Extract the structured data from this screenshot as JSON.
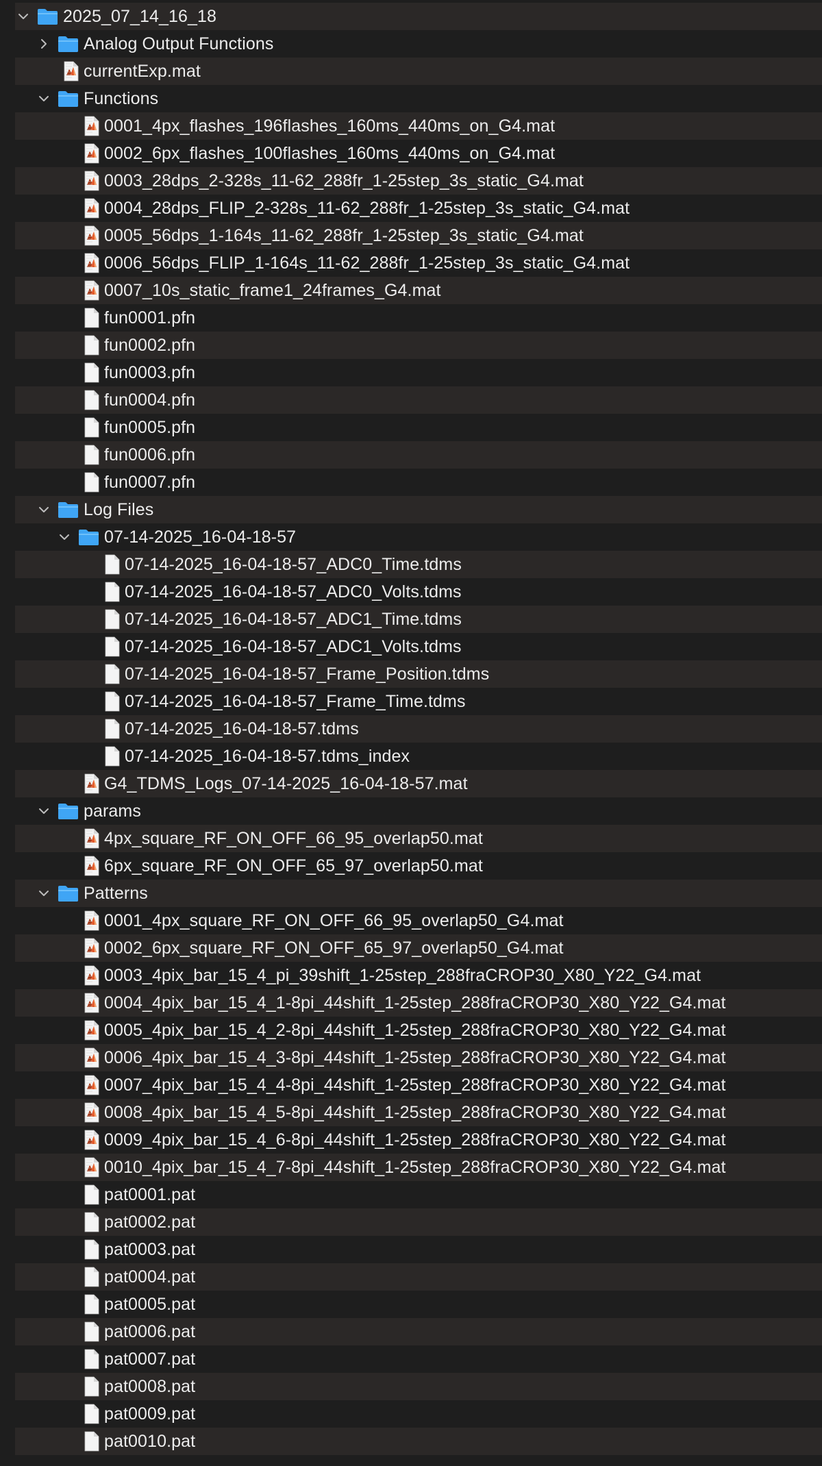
{
  "tree": [
    {
      "label": "2025_07_14_16_18",
      "kind": "folder",
      "depth": 0,
      "expanded": true
    },
    {
      "label": "Analog Output Functions",
      "kind": "folder",
      "depth": 1,
      "expanded": false
    },
    {
      "label": "currentExp.mat",
      "kind": "mat",
      "depth": 1
    },
    {
      "label": "Functions",
      "kind": "folder",
      "depth": 1,
      "expanded": true
    },
    {
      "label": "0001_4px_flashes_196flashes_160ms_440ms_on_G4.mat",
      "kind": "mat",
      "depth": 2
    },
    {
      "label": "0002_6px_flashes_100flashes_160ms_440ms_on_G4.mat",
      "kind": "mat",
      "depth": 2
    },
    {
      "label": "0003_28dps_2-328s_11-62_288fr_1-25step_3s_static_G4.mat",
      "kind": "mat",
      "depth": 2
    },
    {
      "label": "0004_28dps_FLIP_2-328s_11-62_288fr_1-25step_3s_static_G4.mat",
      "kind": "mat",
      "depth": 2
    },
    {
      "label": "0005_56dps_1-164s_11-62_288fr_1-25step_3s_static_G4.mat",
      "kind": "mat",
      "depth": 2
    },
    {
      "label": "0006_56dps_FLIP_1-164s_11-62_288fr_1-25step_3s_static_G4.mat",
      "kind": "mat",
      "depth": 2
    },
    {
      "label": "0007_10s_static_frame1_24frames_G4.mat",
      "kind": "mat",
      "depth": 2
    },
    {
      "label": "fun0001.pfn",
      "kind": "file",
      "depth": 2
    },
    {
      "label": "fun0002.pfn",
      "kind": "file",
      "depth": 2
    },
    {
      "label": "fun0003.pfn",
      "kind": "file",
      "depth": 2
    },
    {
      "label": "fun0004.pfn",
      "kind": "file",
      "depth": 2
    },
    {
      "label": "fun0005.pfn",
      "kind": "file",
      "depth": 2
    },
    {
      "label": "fun0006.pfn",
      "kind": "file",
      "depth": 2
    },
    {
      "label": "fun0007.pfn",
      "kind": "file",
      "depth": 2
    },
    {
      "label": "Log Files",
      "kind": "folder",
      "depth": 1,
      "expanded": true
    },
    {
      "label": "07-14-2025_16-04-18-57",
      "kind": "folder",
      "depth": 2,
      "expanded": true
    },
    {
      "label": "07-14-2025_16-04-18-57_ADC0_Time.tdms",
      "kind": "file",
      "depth": 3
    },
    {
      "label": "07-14-2025_16-04-18-57_ADC0_Volts.tdms",
      "kind": "file",
      "depth": 3
    },
    {
      "label": "07-14-2025_16-04-18-57_ADC1_Time.tdms",
      "kind": "file",
      "depth": 3
    },
    {
      "label": "07-14-2025_16-04-18-57_ADC1_Volts.tdms",
      "kind": "file",
      "depth": 3
    },
    {
      "label": "07-14-2025_16-04-18-57_Frame_Position.tdms",
      "kind": "file",
      "depth": 3
    },
    {
      "label": "07-14-2025_16-04-18-57_Frame_Time.tdms",
      "kind": "file",
      "depth": 3
    },
    {
      "label": "07-14-2025_16-04-18-57.tdms",
      "kind": "file",
      "depth": 3
    },
    {
      "label": "07-14-2025_16-04-18-57.tdms_index",
      "kind": "file",
      "depth": 3
    },
    {
      "label": "G4_TDMS_Logs_07-14-2025_16-04-18-57.mat",
      "kind": "mat",
      "depth": 2
    },
    {
      "label": "params",
      "kind": "folder",
      "depth": 1,
      "expanded": true
    },
    {
      "label": "4px_square_RF_ON_OFF_66_95_overlap50.mat",
      "kind": "mat",
      "depth": 2
    },
    {
      "label": "6px_square_RF_ON_OFF_65_97_overlap50.mat",
      "kind": "mat",
      "depth": 2
    },
    {
      "label": "Patterns",
      "kind": "folder",
      "depth": 1,
      "expanded": true
    },
    {
      "label": "0001_4px_square_RF_ON_OFF_66_95_overlap50_G4.mat",
      "kind": "mat",
      "depth": 2
    },
    {
      "label": "0002_6px_square_RF_ON_OFF_65_97_overlap50_G4.mat",
      "kind": "mat",
      "depth": 2
    },
    {
      "label": "0003_4pix_bar_15_4_pi_39shift_1-25step_288fraCROP30_X80_Y22_G4.mat",
      "kind": "mat",
      "depth": 2
    },
    {
      "label": "0004_4pix_bar_15_4_1-8pi_44shift_1-25step_288fraCROP30_X80_Y22_G4.mat",
      "kind": "mat",
      "depth": 2
    },
    {
      "label": "0005_4pix_bar_15_4_2-8pi_44shift_1-25step_288fraCROP30_X80_Y22_G4.mat",
      "kind": "mat",
      "depth": 2
    },
    {
      "label": "0006_4pix_bar_15_4_3-8pi_44shift_1-25step_288fraCROP30_X80_Y22_G4.mat",
      "kind": "mat",
      "depth": 2
    },
    {
      "label": "0007_4pix_bar_15_4_4-8pi_44shift_1-25step_288fraCROP30_X80_Y22_G4.mat",
      "kind": "mat",
      "depth": 2
    },
    {
      "label": "0008_4pix_bar_15_4_5-8pi_44shift_1-25step_288fraCROP30_X80_Y22_G4.mat",
      "kind": "mat",
      "depth": 2
    },
    {
      "label": "0009_4pix_bar_15_4_6-8pi_44shift_1-25step_288fraCROP30_X80_Y22_G4.mat",
      "kind": "mat",
      "depth": 2
    },
    {
      "label": "0010_4pix_bar_15_4_7-8pi_44shift_1-25step_288fraCROP30_X80_Y22_G4.mat",
      "kind": "mat",
      "depth": 2
    },
    {
      "label": "pat0001.pat",
      "kind": "file",
      "depth": 2
    },
    {
      "label": "pat0002.pat",
      "kind": "file",
      "depth": 2
    },
    {
      "label": "pat0003.pat",
      "kind": "file",
      "depth": 2
    },
    {
      "label": "pat0004.pat",
      "kind": "file",
      "depth": 2
    },
    {
      "label": "pat0005.pat",
      "kind": "file",
      "depth": 2
    },
    {
      "label": "pat0006.pat",
      "kind": "file",
      "depth": 2
    },
    {
      "label": "pat0007.pat",
      "kind": "file",
      "depth": 2
    },
    {
      "label": "pat0008.pat",
      "kind": "file",
      "depth": 2
    },
    {
      "label": "pat0009.pat",
      "kind": "file",
      "depth": 2
    },
    {
      "label": "pat0010.pat",
      "kind": "file",
      "depth": 2
    }
  ],
  "colors": {
    "background": "#1e1e1e",
    "row_alt": "#2b2827",
    "text": "#ececec",
    "folder": "#3fa5f5",
    "folder_tab": "#6ec0fb",
    "chevron": "#bdbdbd",
    "doc": "#f4f4f4"
  },
  "icons": {
    "folder": "folder-icon",
    "mat": "matlab-file-icon",
    "file": "document-icon",
    "expanded": "chevron-down-icon",
    "collapsed": "chevron-right-icon"
  }
}
